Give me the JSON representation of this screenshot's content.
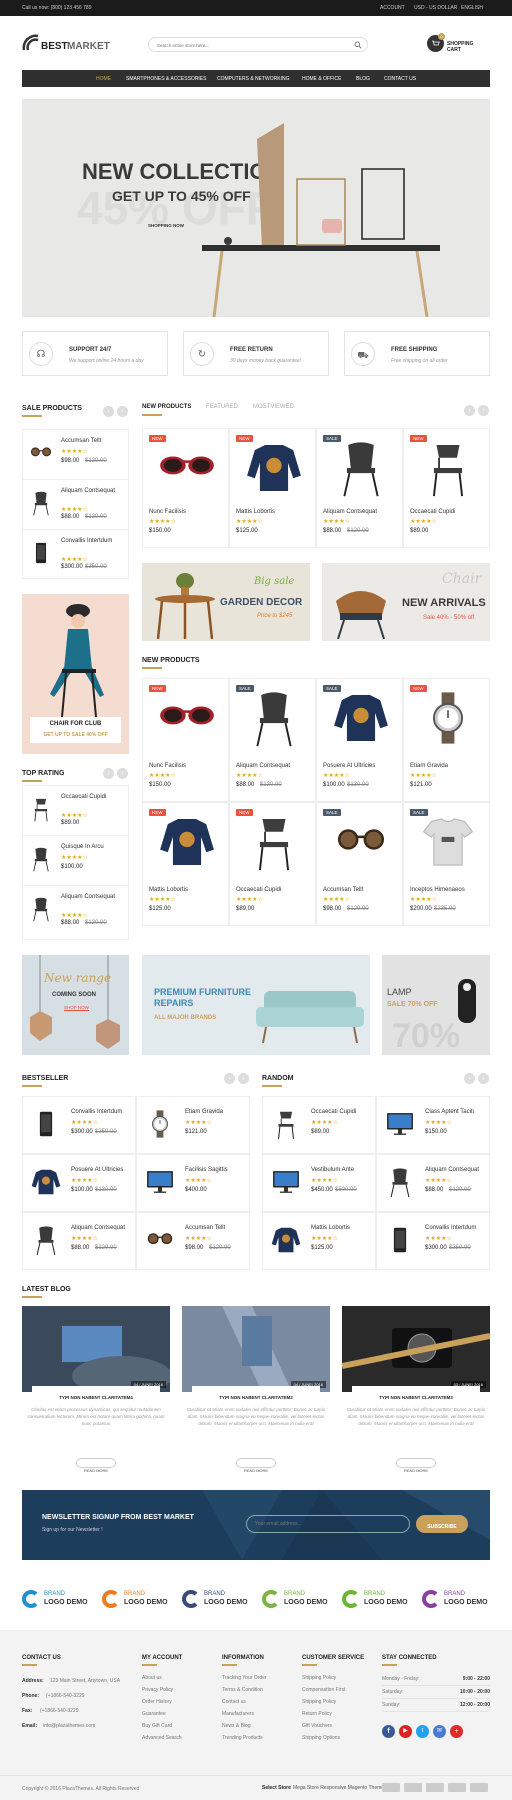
{
  "topbar": {
    "phone": "Call us now: (800) 123 456 789",
    "account": "ACCOUNT",
    "currency": "USD - US DOLLAR",
    "language": "ENGLISH"
  },
  "header": {
    "logo_a": "BEST",
    "logo_b": "MARKET",
    "search_placeholder": "Search entire store here...",
    "cart_label": "SHOPPING CART",
    "cart_count": "0"
  },
  "nav": [
    "HOME",
    "SMARTPHONES & ACCESSORIES",
    "COMPUTERS & NETWORKING",
    "HOME & OFFICE",
    "BLOG",
    "CONTACT US"
  ],
  "hero": {
    "title": "NEW COLLECTION",
    "subtitle": "GET UP TO 45% OFF",
    "ghost": "45% OFF",
    "cta": "SHOPPING NOW"
  },
  "features": [
    {
      "title": "SUPPORT 24/7",
      "desc": "We support online 24 hours a day",
      "icon": "headset-icon"
    },
    {
      "title": "FREE RETURN",
      "desc": "30 days money back guarantee!",
      "icon": "return-icon"
    },
    {
      "title": "FREE SHIPPING",
      "desc": "Free shipping on all order",
      "icon": "truck-icon"
    }
  ],
  "sale_products": {
    "title": "SALE PRODUCTS",
    "items": [
      {
        "name": "Accumsan Tellt",
        "price": "$98.00",
        "old": "$120.00",
        "stars": "★★★★☆"
      },
      {
        "name": "Aliquam Contsequat",
        "price": "$88.00",
        "old": "$120.00",
        "stars": "★★★★☆"
      },
      {
        "name": "Convallis Intertdum",
        "price": "$300.00",
        "old": "$350.00",
        "stars": "★★★★☆"
      }
    ]
  },
  "sidebar_banner": {
    "title": "CHAIR FOR CLUB",
    "subtitle": "GET UP TO SALE 40% OFF"
  },
  "top_rating": {
    "title": "TOP RATING",
    "items": [
      {
        "name": "Occaecati Cupidi",
        "price": "$89.00",
        "old": "",
        "stars": "★★★★☆"
      },
      {
        "name": "Quisque In Arcu",
        "price": "$100.00",
        "old": "",
        "stars": "★★★★☆"
      },
      {
        "name": "Aliquam Contsequat",
        "price": "$88.00",
        "old": "$120.00",
        "stars": "★★★★☆"
      }
    ]
  },
  "tabs": [
    "NEW PRODUCTS",
    "FEATURED",
    "MOSTVIEWED"
  ],
  "tab_products": [
    {
      "name": "Nunc Facilisis",
      "price": "$150.00",
      "old": "",
      "badge": "NEW",
      "img": "sunglasses"
    },
    {
      "name": "Mattis Lobortis",
      "price": "$125.00",
      "old": "",
      "badge": "NEW",
      "img": "sweater"
    },
    {
      "name": "Aliquam Contsequat",
      "price": "$88.00",
      "old": "$120.00",
      "badge": "SALE",
      "img": "chair"
    },
    {
      "name": "Occaecati Cupidi",
      "price": "$89.00",
      "old": "",
      "badge": "NEW",
      "img": "chair2"
    }
  ],
  "promo": [
    {
      "script": "Big sale",
      "title": "GARDEN DECOR",
      "sub": "Price to $245"
    },
    {
      "script": "Chair",
      "title": "NEW ARRIVALS",
      "sub": "Sale 40% - 50% off"
    }
  ],
  "new_products": {
    "title": "NEW PRODUCTS",
    "items": [
      {
        "name": "Nunc Facilisis",
        "price": "$150.00",
        "old": "",
        "badge": "NEW",
        "img": "sunglasses"
      },
      {
        "name": "Aliquam Contsequat",
        "price": "$88.00",
        "old": "$120.00",
        "badge": "SALE",
        "img": "chair"
      },
      {
        "name": "Posuere At Ultricies",
        "price": "$100.00",
        "old": "$130.00",
        "badge": "SALE",
        "img": "sweater"
      },
      {
        "name": "Etiam Gravida",
        "price": "$121.00",
        "old": "",
        "badge": "NEW",
        "img": "watch"
      },
      {
        "name": "Mattis Lobortis",
        "price": "$125.00",
        "old": "",
        "badge": "NEW",
        "img": "sweater"
      },
      {
        "name": "Occaecati Cupidi",
        "price": "$89.00",
        "old": "",
        "badge": "NEW",
        "img": "chair2"
      },
      {
        "name": "Accumsan Tellt",
        "price": "$98.00",
        "old": "$120.00",
        "badge": "SALE",
        "img": "sunglasses2"
      },
      {
        "name": "Inceptos Himenaeos",
        "price": "$200.00",
        "old": "$235.00",
        "badge": "SALE",
        "img": "tshirt"
      }
    ]
  },
  "banners": [
    {
      "script": "New range",
      "sub": "COMING SOON",
      "cta": "SHOP NOW"
    },
    {
      "title1": "PREMIUM FURNITURE",
      "title2": "REPAIRS",
      "sub": "ALL MAJOR BRANDS"
    },
    {
      "title": "LAMP",
      "sub": "SALE 70% OFF",
      "ghost": "70%"
    }
  ],
  "bestseller": {
    "title": "BESTSELLER",
    "items": [
      {
        "name": "Convallis Intertdum",
        "price": "$300.00",
        "old": "$350.00",
        "img": "phone"
      },
      {
        "name": "Etiam Gravida",
        "price": "$121.00",
        "old": "",
        "img": "watch"
      },
      {
        "name": "Posuere At Ultricies",
        "price": "$100.00",
        "old": "$130.00",
        "img": "sweater"
      },
      {
        "name": "Facilisis Sagittis",
        "price": "$400.00",
        "old": "",
        "img": "monitor"
      },
      {
        "name": "Aliquam Contsequat",
        "price": "$88.00",
        "old": "$120.00",
        "img": "chair"
      },
      {
        "name": "Accumsan Tellt",
        "price": "$98.00",
        "old": "$120.00",
        "img": "sunglasses2"
      }
    ]
  },
  "random": {
    "title": "RANDOM",
    "items": [
      {
        "name": "Occaecati Cupidi",
        "price": "$89.00",
        "old": "",
        "img": "chair2"
      },
      {
        "name": "Class Aptent Taciti",
        "price": "$150.00",
        "old": "",
        "img": "monitor"
      },
      {
        "name": "Vestibulum Ante",
        "price": "$450.00",
        "old": "$500.00",
        "img": "monitor"
      },
      {
        "name": "Aliquam Contsequat",
        "price": "$88.00",
        "old": "$120.00",
        "img": "chair"
      },
      {
        "name": "Mattis Lobortis",
        "price": "$125.00",
        "old": "",
        "img": "sweater"
      },
      {
        "name": "Convallis Intertdum",
        "price": "$300.00",
        "old": "$350.00",
        "img": "phone"
      }
    ]
  },
  "blog": {
    "title": "LATEST BLOG",
    "posts": [
      {
        "date": "04 / JUNE/ 2016",
        "title": "TYPI NON HABENT CLARITATEM4",
        "text": "Claritas est etiam processus dynamicus, qui sequitur mutationem consuetudium lectorum. Mirum est notare quam littera gothica, quam nunc putamus",
        "more": "READ MORE"
      },
      {
        "date": "04 / JUNE/ 2016",
        "title": "TYPI NON HABENT CLARITATEM2",
        "text": "Curabitur sit etiam enim sodales nisl efficitur porttitor. Donec ac turpis diam. Mauris bibendum magna eu neque convallis, vel laoreet lectus dictum. Mauris et ullamcorper orci. Maecenas in nulla erat",
        "more": "READ MORE"
      },
      {
        "date": "03 / JUNE/ 2016",
        "title": "TYPI NON HABENT CLARITATEM3",
        "text": "Curabitur sit etiam enim sodales nisl efficitur porttitor. Donec ac turpis diam. Mauris bibendum magna eu neque convallis, vel laoreet lectus dictum. Mauris et ullamcorper orci. Maecenas in nulla erat",
        "more": "READ MORE"
      }
    ]
  },
  "newsletter": {
    "title": "NEWSLETTER SIGNUP FROM BEST MARKET",
    "sub": "Sign up for our Newsletter !",
    "placeholder": "Your email address...",
    "button": "SUBSCRIBE"
  },
  "brands": [
    {
      "a": "BRAND",
      "b": "LOGO DEMO",
      "color": "#1e90d6"
    },
    {
      "a": "BRAND",
      "b": "LOGO DEMO",
      "color": "#f07b1d"
    },
    {
      "a": "BRAND",
      "b": "LOGO DEMO",
      "color": "#3a4a7a"
    },
    {
      "a": "BRAND",
      "b": "LOGO DEMO",
      "color": "#7cb342"
    },
    {
      "a": "BRAND",
      "b": "LOGO DEMO",
      "color": "#6ab82f"
    },
    {
      "a": "BRAND",
      "b": "LOGO DEMO",
      "color": "#8a3fa0"
    }
  ],
  "footer": {
    "contact_title": "CONTACT US",
    "address_label": "Address:",
    "address": "123 Main Street, Anytown, USA",
    "phone_label": "Phone:",
    "phone": "(+1866-540-3229",
    "fax_label": "Fax:",
    "fax": "(+1866-540-3229",
    "email_label": "Email:",
    "email": "info@plazathemes.com",
    "account_title": "MY ACCOUNT",
    "account_links": [
      "About us",
      "Privacy Policy",
      "Order History",
      "Guarantee",
      "Buy Gift Card",
      "Advanced Search"
    ],
    "info_title": "INFORMATION",
    "info_links": [
      "Tracking Your Order",
      "Terms & Condition",
      "Contact us",
      "Manufacturers",
      "News & Blog",
      "Trending Products"
    ],
    "service_title": "CUSTOMER SERVICE",
    "service_links": [
      "Shipping Policy",
      "Compensation First",
      "Shipping Policy",
      "Return Policy",
      "Gift Vouchers",
      "Shipping Options"
    ],
    "stay_title": "STAY CONNECTED",
    "hours": [
      {
        "day": "Monday - Friday:",
        "time": "9:00 - 22:00"
      },
      {
        "day": "Saturday:",
        "time": "10:00 - 20:00"
      },
      {
        "day": "Sunday:",
        "time": "12:00 - 20:00"
      }
    ],
    "copyright": "Copyright © 2016 PlazaThemes. All Rights Reserved",
    "select_store": "Select Store",
    "store_desc": "Mega Store Responsive Magento Theme"
  },
  "colors": {
    "accent": "#c9a15b",
    "dark": "#333333",
    "nav": "#2b2b2b",
    "sale": "#e8523f",
    "navy": "#1d3d5c"
  }
}
